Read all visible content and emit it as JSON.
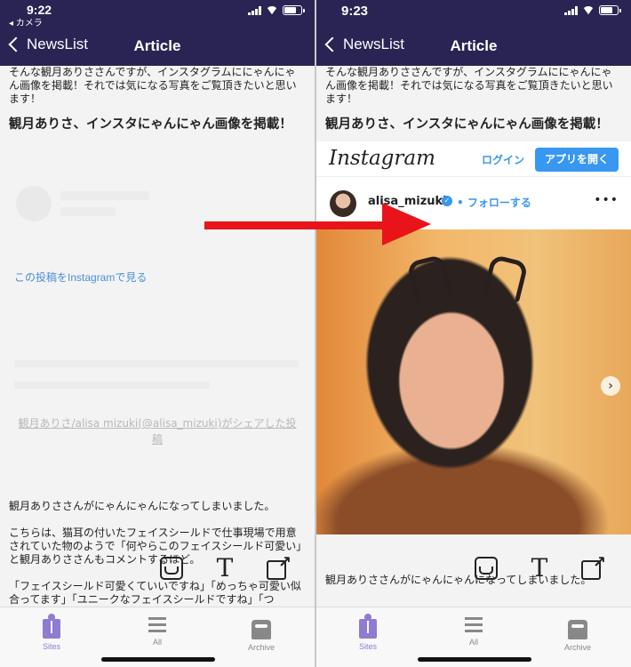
{
  "left_screen": {
    "status_time": "9:22",
    "status_back": "◂ カメラ",
    "nav_back": "NewsList",
    "nav_title": "Article",
    "intro": "そんな観月ありささんですが、インスタグラムににゃんにゃん画像を掲載！それでは気になる写真をご覧頂きたいと思います！",
    "headline": "観月ありさ、インスタにゃんにゃん画像を掲載！",
    "embed_link": "この投稿をInstagramで見る",
    "embed_credit": "観月ありさ/alisa mizuki(@alisa_mizuki)がシェアした投稿",
    "body1": "観月ありささんがにゃんにゃんになってしまいました。",
    "body2": "こちらは、猫耳の付いたフェイスシールドで仕事現場で用意されていた物のようで「何やらこのフェイスシールド可愛い」と観月ありささんもコメントするほど。",
    "body3": "「フェイスシールド可愛くていいですね」「めっちゃ可愛い似合ってます」「ユニークなフェイスシールドですね」「つ"
  },
  "right_screen": {
    "status_time": "9:23",
    "nav_back": "NewsList",
    "nav_title": "Article",
    "intro": "そんな観月ありささんですが、インスタグラムににゃんにゃん画像を掲載！それでは気になる写真をご覧頂きたいと思います！",
    "headline": "観月ありさ、インスタにゃんにゃん画像を掲載！",
    "instagram": {
      "logo": "Instagram",
      "login": "ログイン",
      "open_app": "アプリを開く",
      "username": "alisa_mizuki",
      "follow": "• フォローする",
      "more": "•••"
    },
    "body1": "観月ありささんがにゃんにゃんになってしまいました。"
  },
  "floating_tools": {
    "text_glyph": "T"
  },
  "tabbar": {
    "sites": "Sites",
    "all": "All",
    "archive": "Archive"
  },
  "colors": {
    "nav_bg": "#2a2454",
    "accent": "#8f7bd0",
    "link": "#3897f0",
    "arrow": "#e8141a"
  }
}
